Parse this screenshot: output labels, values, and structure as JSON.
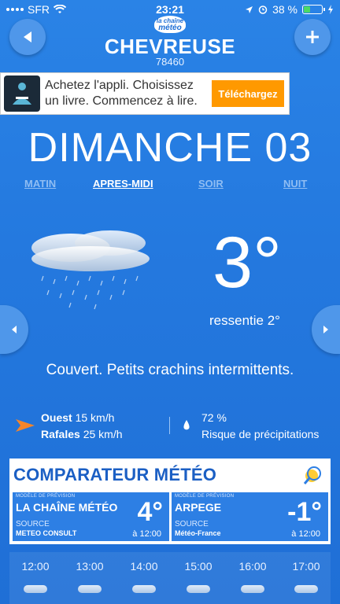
{
  "status": {
    "carrier": "SFR",
    "time": "23:21",
    "battery": "38 %",
    "battery_level": 0.38
  },
  "header": {
    "city": "CHEVREUSE",
    "zip": "78460",
    "logo_small": "la chaîne",
    "logo_big": "météo"
  },
  "ad": {
    "text": "Achetez l'appli. Choisissez un livre. Commencez à lire.",
    "cta": "Téléchargez"
  },
  "day": {
    "title": "DIMANCHE 03"
  },
  "periods": [
    "MATIN",
    "APRES-MIDI",
    "SOIR",
    "NUIT"
  ],
  "weather": {
    "temperature": "3°",
    "felt": "ressentie 2°",
    "description": "Couvert. Petits crachins intermittents."
  },
  "wind": {
    "direction": "Ouest",
    "speed": "15 km/h",
    "gusts_label": "Rafales",
    "gusts": "25 km/h"
  },
  "rain": {
    "probability": "72 %",
    "label": "Risque de précipitations"
  },
  "comparator": {
    "title": "COMPARATEUR MÉTÉO",
    "models": [
      {
        "small": "MODÈLE DE PRÉVISION",
        "name": "LA CHAÎNE MÉTÉO",
        "temp": "4°",
        "source_label": "SOURCE",
        "source": "METEO CONSULT",
        "time": "à 12:00"
      },
      {
        "small": "MODÈLE DE PRÉVISION",
        "name": "ARPEGE",
        "temp": "-1°",
        "source_label": "SOURCE",
        "source": "Météo-France",
        "time": "à 12:00"
      }
    ]
  },
  "hourly": [
    "12:00",
    "13:00",
    "14:00",
    "15:00",
    "16:00",
    "17:00"
  ]
}
